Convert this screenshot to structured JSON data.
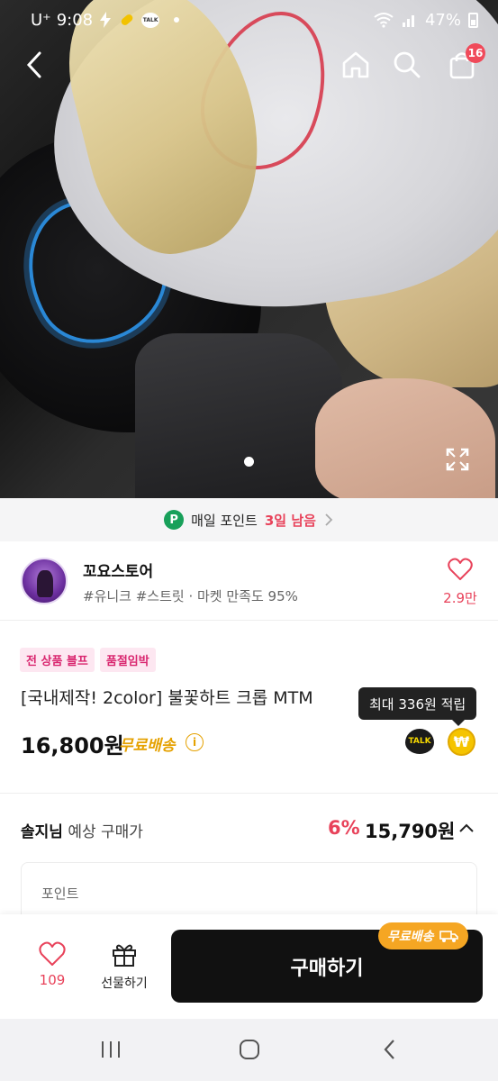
{
  "status_bar": {
    "carrier": "U⁺",
    "time": "9:08",
    "talk_badge": "TALK",
    "battery": "47%"
  },
  "header": {
    "cart_count": "16"
  },
  "daily_point": {
    "icon_letter": "P",
    "label": "매일 포인트",
    "remaining": "3일 남음"
  },
  "store": {
    "name": "꼬요스토어",
    "tags": "#유니크 #스트릿 · 마켓 만족도 95%",
    "like_count": "2.9만"
  },
  "product": {
    "chips": [
      "전 상품 블프",
      "품절임박"
    ],
    "title": "[국내제작! 2color] 불꽃하트 크롭 MTM",
    "price": "16,800원",
    "shipping": "무료배송",
    "info_mark": "i",
    "reward_tooltip": "최대 336원 적립",
    "talk_label": "TALK",
    "coin_symbol": "₩"
  },
  "expected": {
    "user": "솔지님",
    "label": "예상 구매가",
    "discount": "6%",
    "price": "15,790원"
  },
  "point_card": {
    "label": "포인트"
  },
  "action_bar": {
    "like_count": "109",
    "gift_label": "선물하기",
    "buy_label": "구매하기",
    "ship_badge": "무료배송"
  },
  "colors": {
    "accent_pink": "#e8425a",
    "shipping_gold": "#e5a100",
    "point_green": "#18a05a",
    "buy_button": "#111111"
  }
}
